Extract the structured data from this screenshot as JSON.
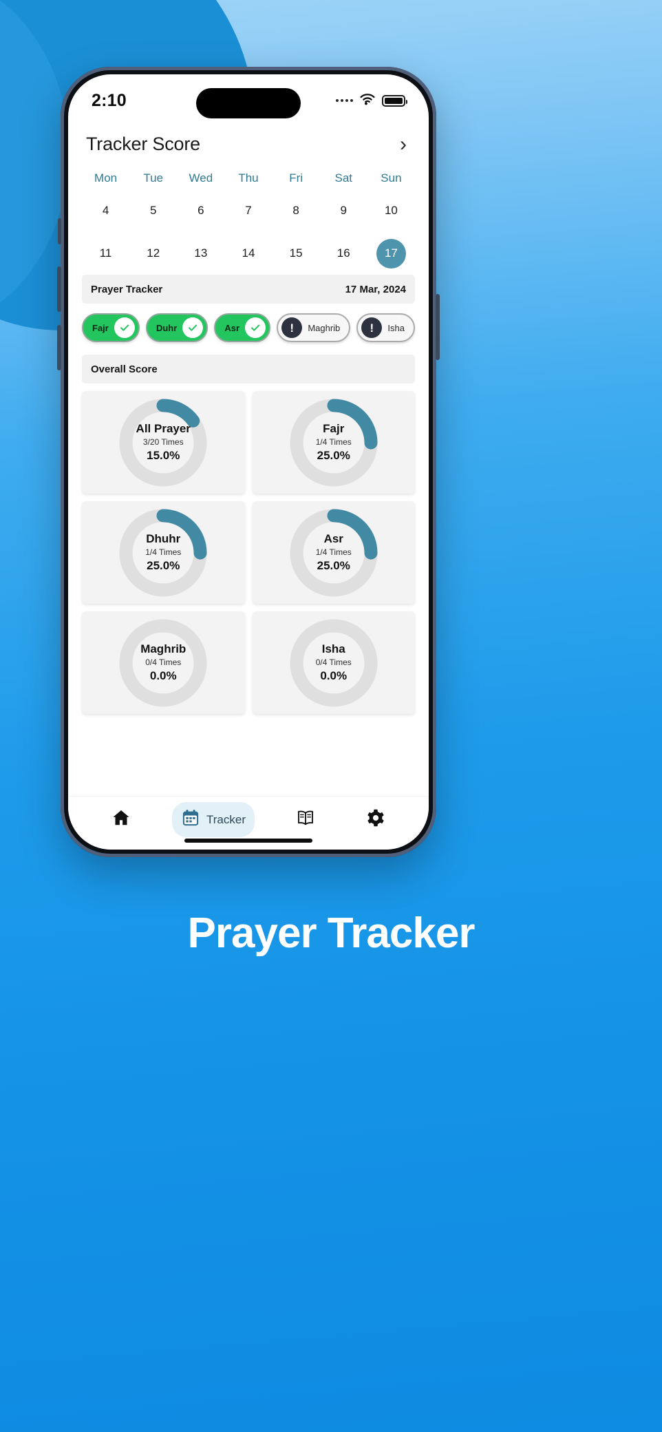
{
  "background": {
    "color": "#1B9BE8"
  },
  "caption": "Prayer Tracker",
  "statusbar": {
    "time": "2:10",
    "signal_icon": "signal-dots-icon",
    "wifi_icon": "wifi-icon",
    "battery_icon": "battery-icon"
  },
  "header": {
    "title": "Tracker Score",
    "chevron_icon": "chevron-right-icon",
    "chevron_glyph": "›"
  },
  "calendar": {
    "dow": [
      "Mon",
      "Tue",
      "Wed",
      "Thu",
      "Fri",
      "Sat",
      "Sun"
    ],
    "week1": [
      "4",
      "5",
      "6",
      "7",
      "8",
      "9",
      "10"
    ],
    "week2": [
      "11",
      "12",
      "13",
      "14",
      "15",
      "16",
      "17"
    ],
    "selected": "17",
    "selected_color": "#4F94AD",
    "dow_color": "#2E7A94"
  },
  "prayer_tracker": {
    "title": "Prayer Tracker",
    "date": "17 Mar, 2024",
    "pills": [
      {
        "label": "Fajr",
        "status": "done",
        "icon": "check-icon"
      },
      {
        "label": "Duhr",
        "status": "done",
        "icon": "check-icon"
      },
      {
        "label": "Asr",
        "status": "done",
        "icon": "check-icon"
      },
      {
        "label": "Maghrib",
        "status": "missed",
        "icon": "exclamation-icon"
      },
      {
        "label": "Isha",
        "status": "missed",
        "icon": "exclamation-icon"
      }
    ],
    "done_color": "#22C55E",
    "missed_color": "#2C3240"
  },
  "overall_score": {
    "title": "Overall Score"
  },
  "chart_data": {
    "type": "pie",
    "title": "Overall Score",
    "legend": "none",
    "track_color": "#DFDFDF",
    "progress_color": "#4289A4",
    "items": [
      {
        "name": "All Prayer",
        "times": "3/20 Times",
        "percent": "15.0%",
        "value": 15,
        "completed": 3,
        "total": 20
      },
      {
        "name": "Fajr",
        "times": "1/4 Times",
        "percent": "25.0%",
        "value": 25,
        "completed": 1,
        "total": 4
      },
      {
        "name": "Dhuhr",
        "times": "1/4 Times",
        "percent": "25.0%",
        "value": 25,
        "completed": 1,
        "total": 4
      },
      {
        "name": "Asr",
        "times": "1/4 Times",
        "percent": "25.0%",
        "value": 25,
        "completed": 1,
        "total": 4
      },
      {
        "name": "Maghrib",
        "times": "0/4 Times",
        "percent": "0.0%",
        "value": 0,
        "completed": 0,
        "total": 4
      },
      {
        "name": "Isha",
        "times": "0/4 Times",
        "percent": "0.0%",
        "value": 0,
        "completed": 0,
        "total": 4
      }
    ]
  },
  "bottomnav": {
    "items": [
      {
        "label": "",
        "icon": "home-icon",
        "active": false
      },
      {
        "label": "Tracker",
        "icon": "calendar-icon",
        "active": true
      },
      {
        "label": "",
        "icon": "book-icon",
        "active": false
      },
      {
        "label": "",
        "icon": "gear-icon",
        "active": false
      }
    ],
    "active_bg": "#E2F0F8"
  }
}
